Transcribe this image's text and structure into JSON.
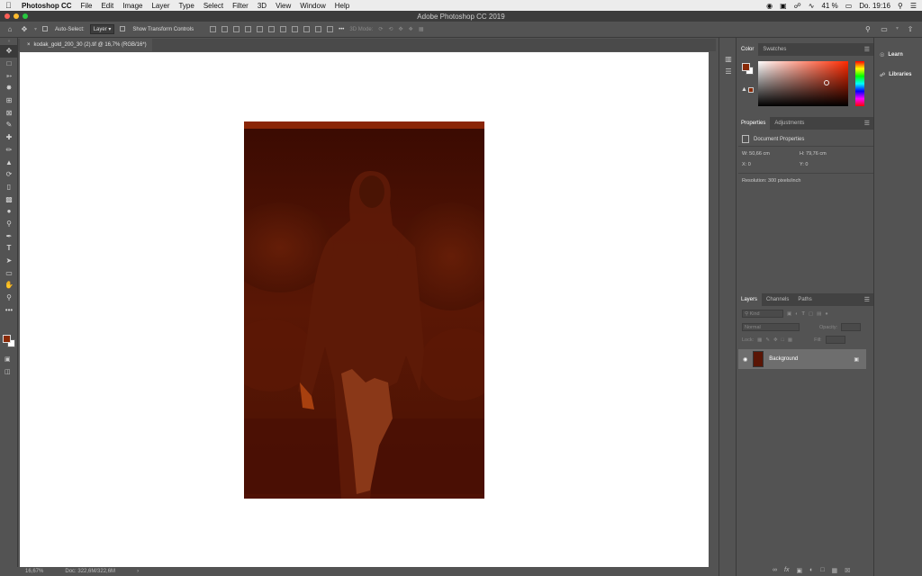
{
  "menubar": {
    "app_name": "Photoshop CC",
    "menus": [
      "File",
      "Edit",
      "Image",
      "Layer",
      "Type",
      "Select",
      "Filter",
      "3D",
      "View",
      "Window",
      "Help"
    ],
    "battery": "41 %",
    "clock": "Do. 19:16"
  },
  "window": {
    "title": "Adobe Photoshop CC 2019"
  },
  "options": {
    "auto_select_label": "Auto-Select:",
    "auto_select_value": "Layer",
    "show_transform_label": "Show Transform Controls",
    "mode_3d_label": "3D Mode:"
  },
  "document": {
    "tab_label": "kodak_gold_200_30 (2).tif @ 16,7% (RGB/16*)",
    "close_glyph": "×"
  },
  "status": {
    "zoom": "16,67%",
    "doc_size": "Doc: 322,6M/322,6M",
    "arrow": "›"
  },
  "color_panel": {
    "tabs": [
      "Color",
      "Swatches"
    ],
    "foreground_color": "#8a2a06",
    "background_color": "#ffffff"
  },
  "properties_panel": {
    "tabs": [
      "Properties",
      "Adjustments"
    ],
    "heading": "Document Properties",
    "width": "W: 50,66 cm",
    "height": "H: 79,76 cm",
    "x": "X: 0",
    "y": "Y: 0",
    "resolution": "Resolution: 300 pixels/inch"
  },
  "layers_panel": {
    "tabs": [
      "Layers",
      "Channels",
      "Paths"
    ],
    "filter_placeholder": "Kind",
    "blend_mode": "Normal",
    "opacity_label": "Opacity:",
    "lock_label": "Lock:",
    "fill_label": "Fill:",
    "layer_name": "Background"
  },
  "far_right": {
    "items": [
      {
        "label": "Learn",
        "icon": "lightbulb-icon"
      },
      {
        "label": "Libraries",
        "icon": "libraries-icon"
      }
    ]
  },
  "tools": [
    "move",
    "marquee",
    "lasso",
    "quick-select",
    "crop",
    "frame",
    "eyedropper",
    "healing",
    "brush",
    "stamp",
    "history-brush",
    "eraser",
    "gradient",
    "blur",
    "dodge",
    "pen",
    "type",
    "path-select",
    "shape",
    "hand",
    "zoom",
    "more"
  ]
}
